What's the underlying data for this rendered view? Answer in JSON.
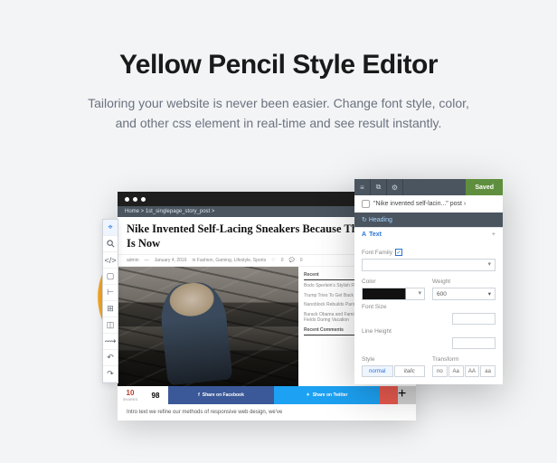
{
  "hero": {
    "title": "Yellow Pencil Style Editor",
    "subtitle": "Tailoring your website is never been easier. Change font style, color, and other css element in real-time and see result instantly."
  },
  "browser": {
    "breadcrumb": "Home > 1st_singlepage_story_post > ",
    "article_title": "Nike Invented Self-Lacing Sneakers Because The Future Is Now",
    "meta": {
      "author": "admin",
      "date": "January 4, 2016",
      "cats": "in Fashion, Gaming, Lifestyle, Sports",
      "likes": "0",
      "comments": "0"
    },
    "sidebar": {
      "recent_h": "Recent",
      "items": [
        "Bodo Sperlein's Stylish Flatware",
        "Trump Tries To Get Back On Track",
        "Nanoblock Rebuilds Paris's Notre Dame",
        "Barack Obama and Family Visit Balinese Paddy Fields During Vacation"
      ],
      "comments_h": "Recent Comments"
    },
    "shares": {
      "total": "10",
      "total_l": "SHARES",
      "fb_n": "98",
      "fb": "Share on Facebook",
      "tw": "Share on Twitter"
    },
    "intro": "Intro text we refine our methods of responsive web design, we've"
  },
  "panel": {
    "saved": "Saved",
    "context": "\"Nike invented self-lacin...\" post ›",
    "heading": "Heading",
    "section": "Text",
    "font_family": "Font Family",
    "color": "Color",
    "weight": "Weight",
    "weight_val": "600",
    "font_size": "Font Size",
    "line_height": "Line Height",
    "style": "Style",
    "transform": "Transform",
    "styles": [
      "normal",
      "italic"
    ],
    "transforms": [
      "no",
      "Aa",
      "AA",
      "aa"
    ]
  }
}
